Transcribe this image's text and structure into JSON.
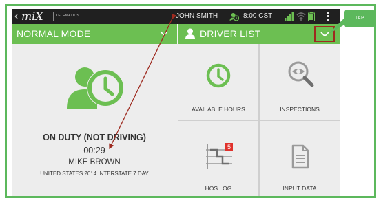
{
  "statusbar": {
    "back_glyph": "‹",
    "logo": "miX",
    "logo_sub": "TELEMATICS",
    "user_name": "JOHN SMITH",
    "time": "8:00 CST",
    "icons": [
      "clock-icon",
      "signal-icon",
      "wifi-icon",
      "battery-icon",
      "overflow-menu-icon"
    ]
  },
  "mode_bar": {
    "label": "NORMAL MODE",
    "icon": "chevron-down-icon"
  },
  "driver_bar": {
    "label": "DRIVER LIST",
    "icon": "person-icon",
    "toggle_icon": "chevron-down-icon"
  },
  "status_panel": {
    "icon": "on-duty-clock-icon",
    "duty_status": "ON DUTY (NOT DRIVING)",
    "duty_time": "00:29",
    "driver_name": "MIKE BROWN",
    "ruleset": "UNITED STATES 2014 INTERSTATE 7 DAY"
  },
  "tiles": [
    {
      "label": "AVAILABLE HOURS",
      "icon": "available-hours-clock-icon"
    },
    {
      "label": "INSPECTIONS",
      "icon": "magnifier-eye-icon"
    },
    {
      "label": "HOS LOG",
      "icon": "hos-log-icon",
      "badge": "5"
    },
    {
      "label": "INPUT DATA",
      "icon": "document-icon"
    }
  ],
  "annotation": {
    "callout_label": "TAP"
  },
  "colors": {
    "accent_green": "#6cbf52",
    "frame_green": "#5cb85c",
    "status_bar": "#202020",
    "highlight_border": "#9e2a1f",
    "badge_red": "#e0312b",
    "arrow": "#9e2a1f"
  }
}
